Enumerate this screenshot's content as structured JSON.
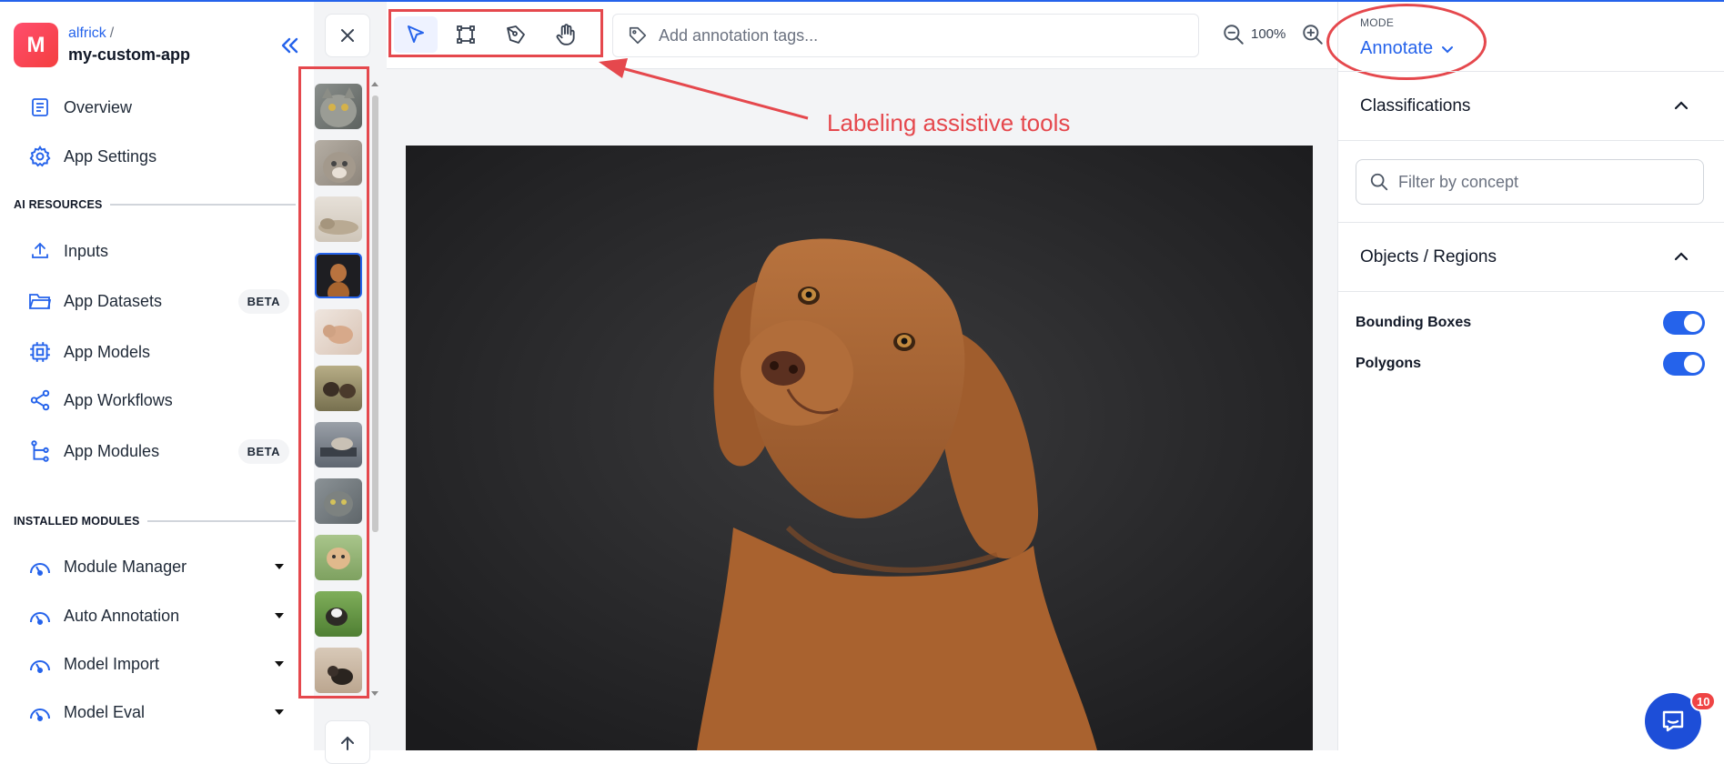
{
  "app": {
    "avatar_letter": "M",
    "owner": "alfrick",
    "owner_separator": "/",
    "name": "my-custom-app"
  },
  "sidebar": {
    "items": [
      {
        "label": "Overview",
        "icon": "document-icon"
      },
      {
        "label": "App Settings",
        "icon": "gear-icon"
      }
    ],
    "ai_resources_label": "AI RESOURCES",
    "ai_items": [
      {
        "label": "Inputs",
        "icon": "upload-icon",
        "badge": ""
      },
      {
        "label": "App Datasets",
        "icon": "folder-icon",
        "badge": "BETA"
      },
      {
        "label": "App Models",
        "icon": "chip-icon",
        "badge": ""
      },
      {
        "label": "App Workflows",
        "icon": "share-nodes-icon",
        "badge": ""
      },
      {
        "label": "App Modules",
        "icon": "tree-icon",
        "badge": "BETA"
      }
    ],
    "installed_modules_label": "INSTALLED MODULES",
    "modules": [
      {
        "label": "Module Manager",
        "icon": "gauge-icon"
      },
      {
        "label": "Auto Annotation",
        "icon": "gauge-icon"
      },
      {
        "label": "Model Import",
        "icon": "gauge-icon"
      },
      {
        "label": "Model Eval",
        "icon": "gauge-icon"
      }
    ]
  },
  "toolbar": {
    "tools": [
      "select-tool",
      "bounding-box-tool",
      "polygon-pen-tool",
      "pan-hand-tool"
    ],
    "active_tool": "select-tool",
    "tag_placeholder": "Add annotation tags...",
    "zoom": "100%"
  },
  "annotation": {
    "callout_text": "Labeling assistive tools",
    "color": "#e5484d"
  },
  "thumbnails": {
    "count": 11,
    "active_index": 3
  },
  "right_panel": {
    "mode_label": "MODE",
    "mode_value": "Annotate",
    "classifications_label": "Classifications",
    "filter_placeholder": "Filter by concept",
    "objects_label": "Objects / Regions",
    "toggles": [
      {
        "label": "Bounding Boxes",
        "on": true
      },
      {
        "label": "Polygons",
        "on": true
      }
    ]
  },
  "chat": {
    "unread_count": "10"
  },
  "colors": {
    "accent": "#2563eb",
    "annotation_red": "#e5484d"
  }
}
